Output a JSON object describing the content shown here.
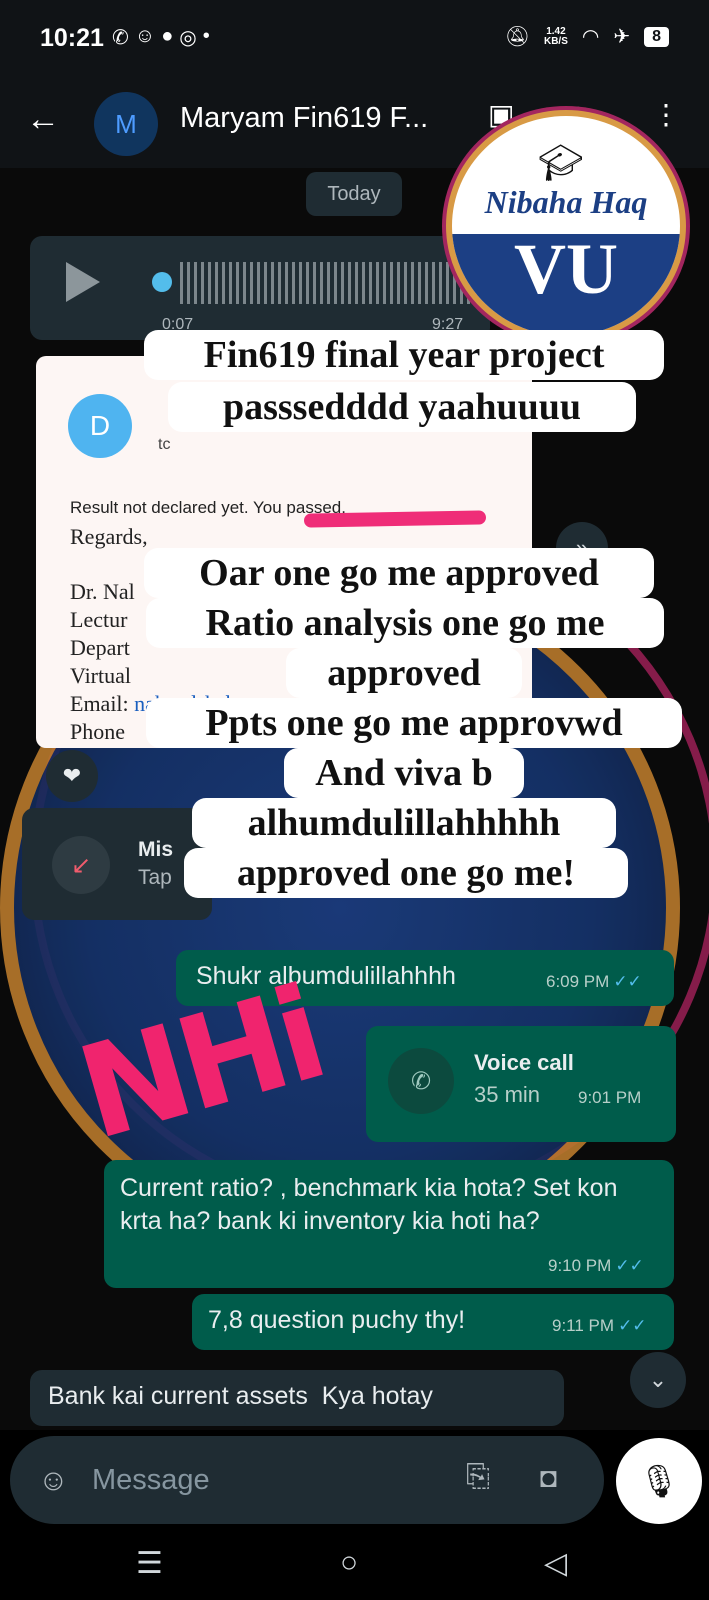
{
  "status_bar": {
    "time": "10:21",
    "left_icons": [
      "whatsapp-icon",
      "snapchat-icon",
      "message-icon",
      "instagram-icon",
      "dot-icon"
    ],
    "net_speed_value": "1.42",
    "net_speed_unit": "KB/S",
    "battery": "8"
  },
  "header": {
    "avatar_letter": "M",
    "title": "Maryam Fin619 F..."
  },
  "chat": {
    "date_chip": "Today",
    "audio": {
      "duration": "0:07",
      "time": "9:27 AM"
    },
    "email": {
      "avatar_letter": "D",
      "to": "tc",
      "result_line": "Result not declared yet. You passed.",
      "regards": "Regards,",
      "lines": [
        "Dr. Nal",
        "Lectur",
        "Depart",
        "Virtual",
        "Email:",
        "Phone"
      ],
      "email_link": "naheedshaba"
    },
    "missed_call": {
      "title": "Mis",
      "subtitle": "Tap"
    },
    "messages": [
      {
        "id": "shukr",
        "text": "Shukr albumdulillahhhh",
        "time": "6:09 PM"
      },
      {
        "id": "current",
        "text": "Current ratio? , benchmark kia hota? Set kon krta ha? bank ki inventory kia hoti ha?",
        "time": "9:10 PM"
      },
      {
        "id": "q78",
        "text": "7,8 question puchy thy!",
        "time": "9:11 PM"
      },
      {
        "id": "bank",
        "text": "Bank kai current assets  Kya hotay"
      }
    ],
    "voice_call": {
      "title": "Voice call",
      "duration": "35 min",
      "time": "9:01 PM"
    }
  },
  "composer": {
    "placeholder": "Message"
  },
  "overlay": {
    "caption1": [
      "Fin619 final year project",
      "passsedddd yaahuuuu"
    ],
    "caption2": [
      "Oar one go me approved",
      "Ratio analysis one go me",
      "approved",
      "Ppts one go me approvwd",
      "And viva b",
      "alhumdulillahhhhh",
      "approved one go me!"
    ],
    "scribble": "NHi",
    "logo_name": "Nibaha Haq",
    "logo_vu": "VU"
  },
  "colors": {
    "out_bubble": "#005c4b",
    "in_bubble": "#1f2c33",
    "accent_blue": "#53bdeb",
    "scribble_pink": "#f0246e"
  }
}
